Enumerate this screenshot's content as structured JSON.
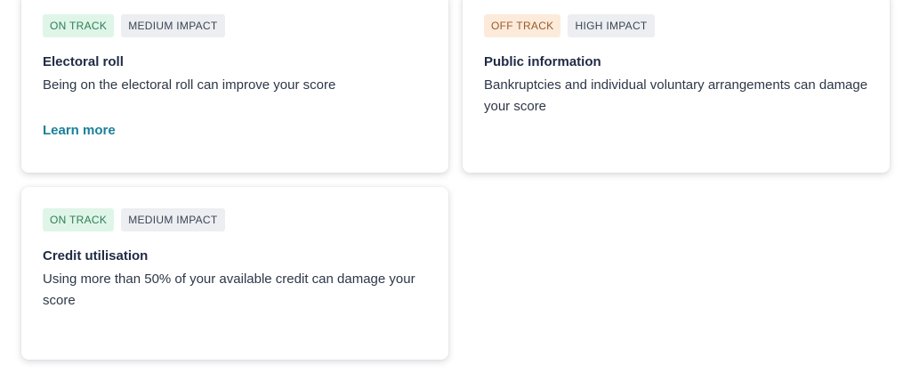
{
  "cards": [
    {
      "status": "ON TRACK",
      "impact": "MEDIUM IMPACT",
      "title": "Electoral roll",
      "description": "Being on the electoral roll can improve your score",
      "link": "Learn more"
    },
    {
      "status": "OFF TRACK",
      "impact": "HIGH IMPACT",
      "title": "Public information",
      "description": "Bankruptcies and individual voluntary arrangements can damage your score"
    },
    {
      "status": "ON TRACK",
      "impact": "MEDIUM IMPACT",
      "title": "Credit utilisation",
      "description": "Using more than 50% of your available credit can damage your score"
    }
  ],
  "colors": {
    "on_track_bg": "#dff5e8",
    "on_track_text": "#2f7d55",
    "off_track_bg": "#fcebdb",
    "off_track_text": "#9a5a2b",
    "impact_bg": "#eceef1",
    "link": "#1a8098"
  }
}
